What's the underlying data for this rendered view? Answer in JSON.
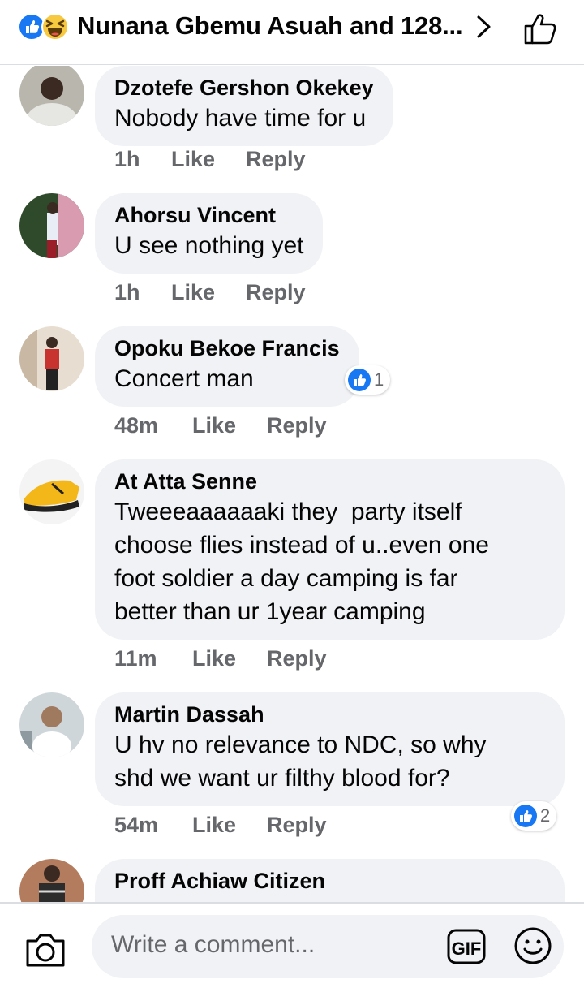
{
  "header": {
    "title": "Nunana Gbemu Asuah and 128...",
    "reaction_icons": [
      "like-icon",
      "haha-icon"
    ]
  },
  "comments": [
    {
      "author": "Dzotefe Gershon Okekey",
      "text": "Nobody have time for u",
      "time": "1h",
      "like_label": "Like",
      "reply_label": "Reply"
    },
    {
      "author": "Ahorsu Vincent",
      "text": "U see nothing yet",
      "time": "1h",
      "like_label": "Like",
      "reply_label": "Reply"
    },
    {
      "author": "Opoku Bekoe Francis",
      "text": "Concert man",
      "time": "48m",
      "like_label": "Like",
      "reply_label": "Reply",
      "reactions": "1"
    },
    {
      "author": "At Atta Senne",
      "text": "Tweeeaaaaaaki they  party itself\nchoose flies instead of u..even one\nfoot soldier a day camping is far\nbetter than ur 1year camping",
      "time": "11m",
      "like_label": "Like",
      "reply_label": "Reply"
    },
    {
      "author": "Martin Dassah",
      "text": "U hv no relevance to NDC, so why\nshd we want ur filthy blood for?",
      "time": "54m",
      "like_label": "Like",
      "reply_label": "Reply",
      "reactions": "2"
    },
    {
      "author": "Proff Achiaw Citizen"
    }
  ],
  "composer": {
    "placeholder": "Write a comment...",
    "gif_label": "GIF"
  },
  "colors": {
    "like_blue": "#1877f2",
    "bubble_bg": "#f0f2f5",
    "meta_gray": "#65676b"
  }
}
